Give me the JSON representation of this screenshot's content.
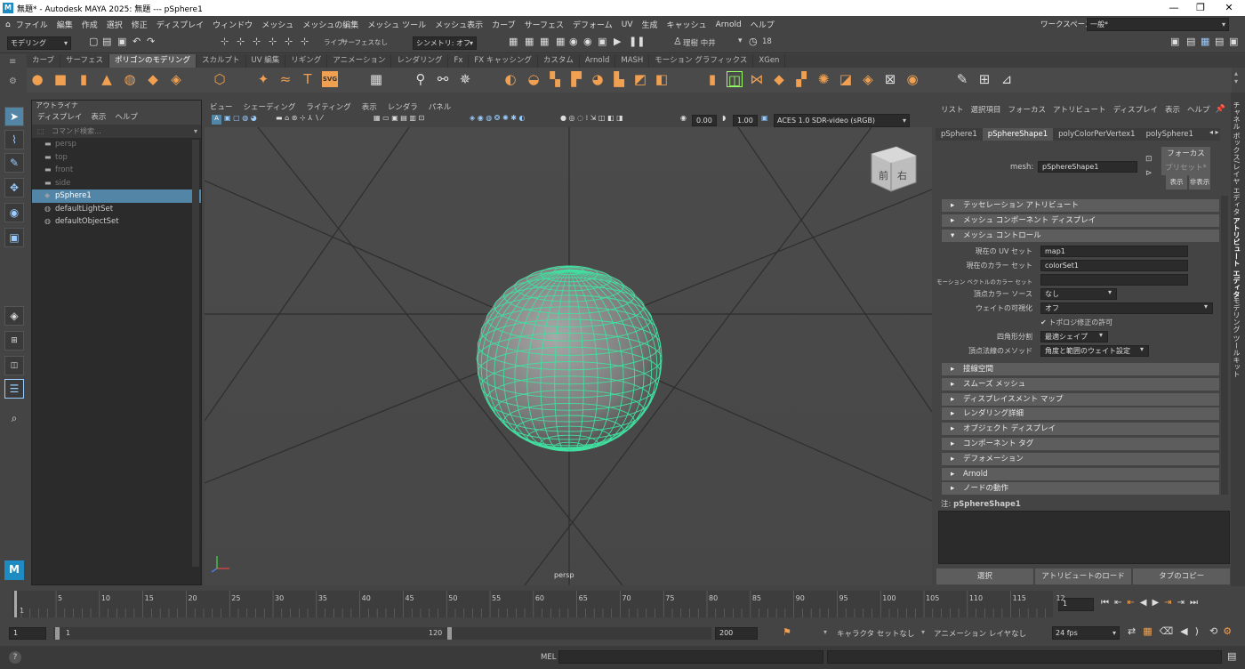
{
  "titlebar": {
    "icon": "M",
    "title": "無題* - Autodesk MAYA 2025: 無題   ---   pSphere1"
  },
  "menubar": {
    "items": [
      "ファイル",
      "編集",
      "作成",
      "選択",
      "修正",
      "ディスプレイ",
      "ウィンドウ",
      "メッシュ",
      "メッシュの編集",
      "メッシュ ツール",
      "メッシュ表示",
      "カーブ",
      "サーフェス",
      "デフォーム",
      "UV",
      "生成",
      "キャッシュ",
      "Arnold",
      "ヘルプ"
    ],
    "workspace_label": "ワークスペース:",
    "workspace_value": "一般*"
  },
  "statusline": {
    "mode": "モデリング",
    "live_label": "ライブ",
    "live_value": "サーフェスなし",
    "symmetry": "シンメトリ: オフ",
    "user": "理樹 中井",
    "notifications": "18",
    "cam_value1": "0.00",
    "cam_value2": "1.00",
    "color_space": "ACES 1.0 SDR-video (sRGB)"
  },
  "shelf": {
    "tabs": [
      "カーブ",
      "サーフェス",
      "ポリゴンのモデリング",
      "スカルプト",
      "UV 編集",
      "リギング",
      "アニメーション",
      "レンダリング",
      "Fx",
      "FX キャッシング",
      "カスタム",
      "Arnold",
      "MASH",
      "モーション グラフィックス",
      "XGen"
    ],
    "active_tab": 2,
    "svg_label": "SVG"
  },
  "outliner": {
    "title": "アウトライナ",
    "menu": [
      "ディスプレイ",
      "表示",
      "ヘルプ"
    ],
    "search_placeholder": "コマンド検索...",
    "items": [
      {
        "name": "persp",
        "icon": "camera-icon",
        "dim": true
      },
      {
        "name": "top",
        "icon": "camera-icon",
        "dim": true
      },
      {
        "name": "front",
        "icon": "camera-icon",
        "dim": true
      },
      {
        "name": "side",
        "icon": "camera-icon",
        "dim": true
      },
      {
        "name": "pSphere1",
        "icon": "mesh-icon",
        "selected": true
      },
      {
        "name": "defaultLightSet",
        "icon": "set-icon"
      },
      {
        "name": "defaultObjectSet",
        "icon": "set-icon"
      }
    ]
  },
  "viewport": {
    "menu": [
      "ビュー",
      "シェーディング",
      "ライティング",
      "表示",
      "レンダラ",
      "パネル"
    ],
    "camera_label": "persp",
    "viewcube_front": "前",
    "viewcube_right": "右",
    "wire_color": "#40e0a0"
  },
  "attribute_editor": {
    "menu": [
      "リスト",
      "選択項目",
      "フォーカス",
      "アトリビュート",
      "ディスプレイ",
      "表示",
      "ヘルプ"
    ],
    "tabs": [
      "pSphere1",
      "pSphereShape1",
      "polyColorPerVertex1",
      "polySphere1"
    ],
    "active_tab": 1,
    "mesh_label": "mesh:",
    "mesh_value": "pSphereShape1",
    "focus_button": "フォーカス",
    "preset_button": "プリセット*",
    "show_button": "表示",
    "hide_button": "非表示",
    "sections_top": [
      "テッセレーション アトリビュート",
      "メッシュ コンポーネント ディスプレイ",
      "メッシュ コントロール"
    ],
    "fields": [
      {
        "label": "現在の UV セット",
        "value": "map1"
      },
      {
        "label": "現在のカラー セット",
        "value": "colorSet1"
      },
      {
        "label": "モーション ベクトルのカラー セット",
        "value": ""
      },
      {
        "label": "頂点カラー ソース",
        "value": "なし"
      },
      {
        "label": "ウェイトの可視化",
        "value": "オフ"
      }
    ],
    "checkbox_label": "トポロジ修正の許可",
    "quad_label": "四角形分割",
    "quad_value": "最適シェイプ",
    "normal_label": "頂点法線のメソッド",
    "normal_value": "角度と範囲のウェイト設定",
    "sections_bottom": [
      "接線空間",
      "スムーズ メッシュ",
      "ディスプレイスメント マップ",
      "レンダリング詳細",
      "オブジェクト ディスプレイ",
      "コンポーネント タグ",
      "デフォメーション",
      "Arnold",
      "ノードの動作"
    ],
    "notes_label": "注:",
    "notes_value": "pSphereShape1",
    "buttons": [
      "選択",
      "アトリビュートのロード",
      "タブのコピー"
    ]
  },
  "right_strip": [
    "チャネル ボックス/レイヤ エディタ",
    "アトリビュート エディタ",
    "モデリング ツールキット"
  ],
  "timeline": {
    "ticks": [
      "5",
      "10",
      "15",
      "20",
      "25",
      "30",
      "35",
      "40",
      "45",
      "50",
      "55",
      "60",
      "65",
      "70",
      "75",
      "80",
      "85",
      "90",
      "95",
      "100",
      "105",
      "110",
      "115",
      "12"
    ],
    "current_frame": "1",
    "start_marker": "1"
  },
  "range": {
    "start": "1",
    "inner_start": "1",
    "inner_end": "120",
    "end": "200",
    "character_set": "キャラクタ セットなし",
    "anim_layer": "アニメーション レイヤなし",
    "fps": "24 fps"
  },
  "cmdline": {
    "lang": "MEL",
    "help_icon": "?"
  }
}
